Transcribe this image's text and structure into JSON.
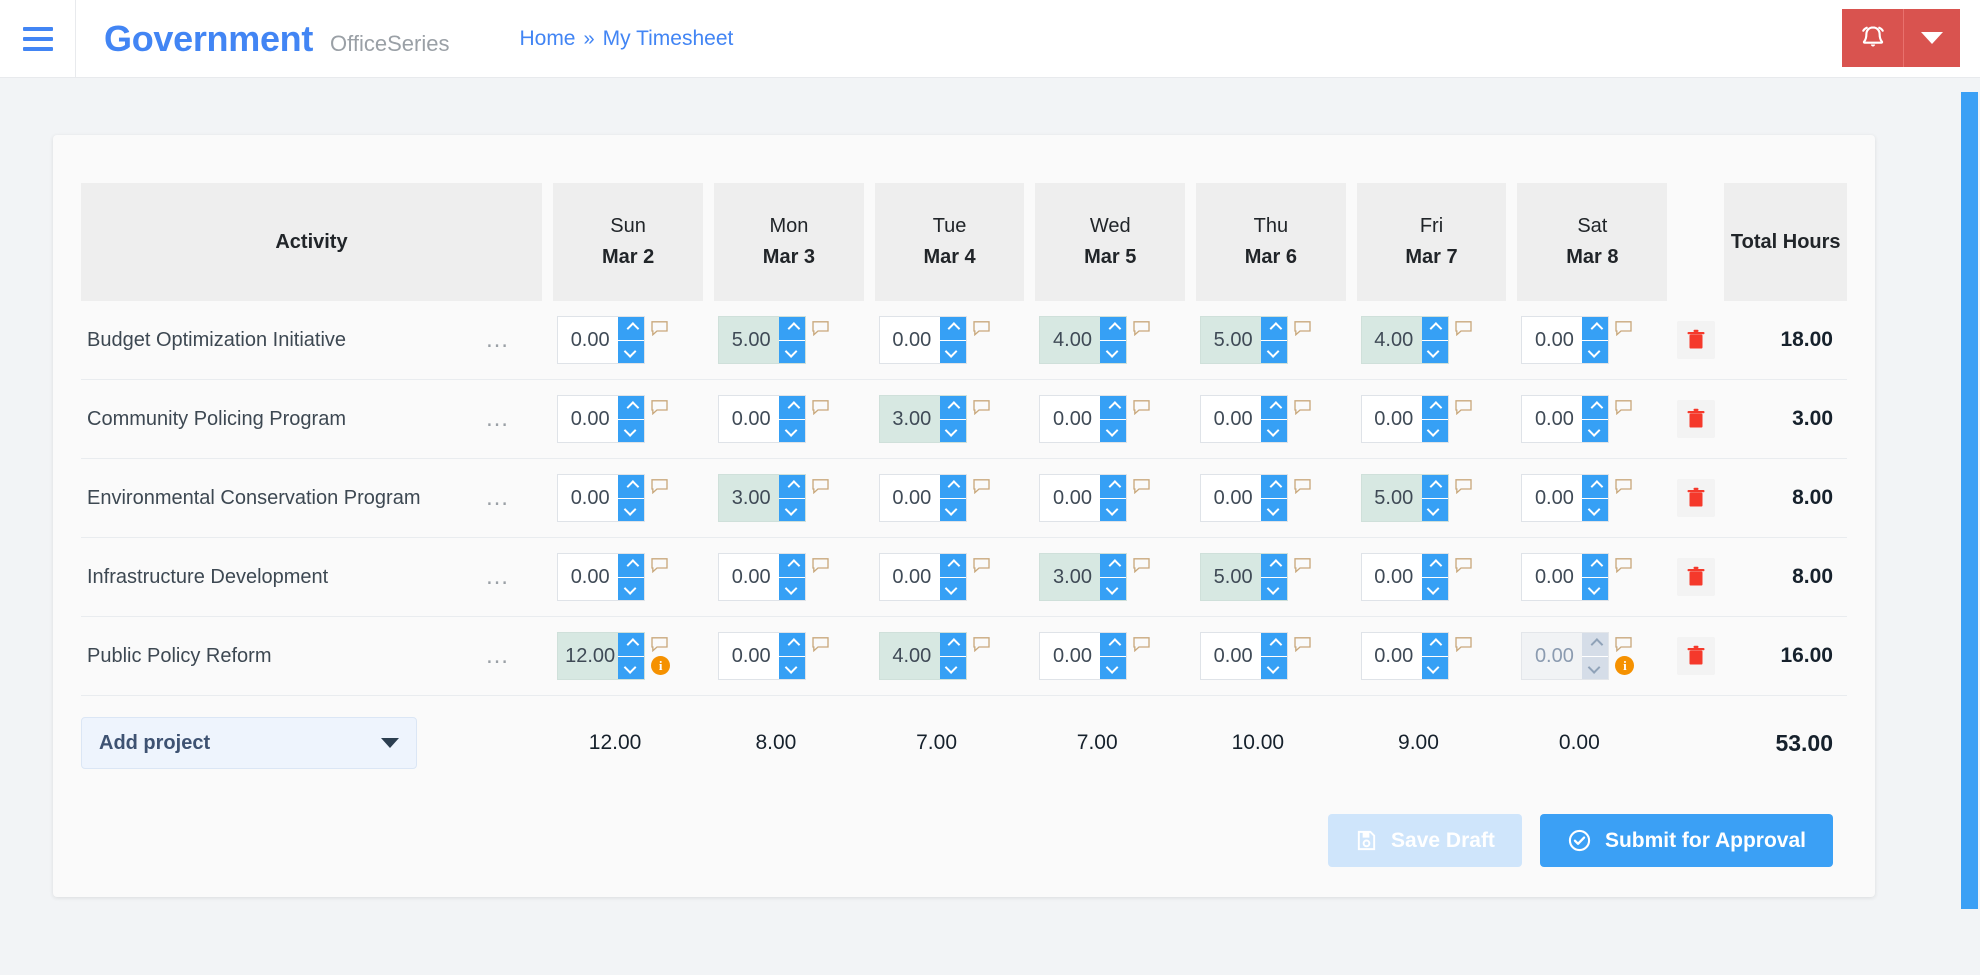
{
  "header": {
    "menu_icon": "hamburger-icon",
    "brand": "Government",
    "brand_sub": "OfficeSeries",
    "breadcrumb": {
      "home": "Home",
      "separator": "»",
      "current": "My Timesheet"
    },
    "notify_icon": "alarm-bell-icon",
    "notify_caret_icon": "chevron-down-icon",
    "accent_red": "#d9534f",
    "accent_blue": "#4285f4"
  },
  "table": {
    "columns": {
      "activity": "Activity",
      "total": "Total Hours",
      "days": [
        {
          "dow": "Sun",
          "date": "Mar 2"
        },
        {
          "dow": "Mon",
          "date": "Mar 3"
        },
        {
          "dow": "Tue",
          "date": "Mar 4"
        },
        {
          "dow": "Wed",
          "date": "Mar 5"
        },
        {
          "dow": "Thu",
          "date": "Mar 6"
        },
        {
          "dow": "Fri",
          "date": "Mar 7"
        },
        {
          "dow": "Sat",
          "date": "Mar 8"
        }
      ]
    },
    "rows": [
      {
        "activity": "Budget Optimization Initiative",
        "menu_icon": "ellipsis-icon",
        "delete_icon": "trash-icon",
        "total": "18.00",
        "cells": [
          {
            "value": "0.00",
            "filled": false,
            "disabled": false,
            "warning": false
          },
          {
            "value": "5.00",
            "filled": true,
            "disabled": false,
            "warning": false
          },
          {
            "value": "0.00",
            "filled": false,
            "disabled": false,
            "warning": false
          },
          {
            "value": "4.00",
            "filled": true,
            "disabled": false,
            "warning": false
          },
          {
            "value": "5.00",
            "filled": true,
            "disabled": false,
            "warning": false
          },
          {
            "value": "4.00",
            "filled": true,
            "disabled": false,
            "warning": false
          },
          {
            "value": "0.00",
            "filled": false,
            "disabled": false,
            "warning": false
          }
        ]
      },
      {
        "activity": "Community Policing Program",
        "menu_icon": "ellipsis-icon",
        "delete_icon": "trash-icon",
        "total": "3.00",
        "cells": [
          {
            "value": "0.00",
            "filled": false,
            "disabled": false,
            "warning": false
          },
          {
            "value": "0.00",
            "filled": false,
            "disabled": false,
            "warning": false
          },
          {
            "value": "3.00",
            "filled": true,
            "disabled": false,
            "warning": false
          },
          {
            "value": "0.00",
            "filled": false,
            "disabled": false,
            "warning": false
          },
          {
            "value": "0.00",
            "filled": false,
            "disabled": false,
            "warning": false
          },
          {
            "value": "0.00",
            "filled": false,
            "disabled": false,
            "warning": false
          },
          {
            "value": "0.00",
            "filled": false,
            "disabled": false,
            "warning": false
          }
        ]
      },
      {
        "activity": "Environmental Conservation Program",
        "menu_icon": "ellipsis-icon",
        "delete_icon": "trash-icon",
        "total": "8.00",
        "cells": [
          {
            "value": "0.00",
            "filled": false,
            "disabled": false,
            "warning": false
          },
          {
            "value": "3.00",
            "filled": true,
            "disabled": false,
            "warning": false
          },
          {
            "value": "0.00",
            "filled": false,
            "disabled": false,
            "warning": false
          },
          {
            "value": "0.00",
            "filled": false,
            "disabled": false,
            "warning": false
          },
          {
            "value": "0.00",
            "filled": false,
            "disabled": false,
            "warning": false
          },
          {
            "value": "5.00",
            "filled": true,
            "disabled": false,
            "warning": false
          },
          {
            "value": "0.00",
            "filled": false,
            "disabled": false,
            "warning": false
          }
        ]
      },
      {
        "activity": "Infrastructure Development",
        "menu_icon": "ellipsis-icon",
        "delete_icon": "trash-icon",
        "total": "8.00",
        "cells": [
          {
            "value": "0.00",
            "filled": false,
            "disabled": false,
            "warning": false
          },
          {
            "value": "0.00",
            "filled": false,
            "disabled": false,
            "warning": false
          },
          {
            "value": "0.00",
            "filled": false,
            "disabled": false,
            "warning": false
          },
          {
            "value": "3.00",
            "filled": true,
            "disabled": false,
            "warning": false
          },
          {
            "value": "5.00",
            "filled": true,
            "disabled": false,
            "warning": false
          },
          {
            "value": "0.00",
            "filled": false,
            "disabled": false,
            "warning": false
          },
          {
            "value": "0.00",
            "filled": false,
            "disabled": false,
            "warning": false
          }
        ]
      },
      {
        "activity": "Public Policy Reform",
        "menu_icon": "ellipsis-icon",
        "delete_icon": "trash-icon",
        "total": "16.00",
        "cells": [
          {
            "value": "12.00",
            "filled": true,
            "disabled": false,
            "warning": true
          },
          {
            "value": "0.00",
            "filled": false,
            "disabled": false,
            "warning": false
          },
          {
            "value": "4.00",
            "filled": true,
            "disabled": false,
            "warning": false
          },
          {
            "value": "0.00",
            "filled": false,
            "disabled": false,
            "warning": false
          },
          {
            "value": "0.00",
            "filled": false,
            "disabled": false,
            "warning": false
          },
          {
            "value": "0.00",
            "filled": false,
            "disabled": false,
            "warning": false
          },
          {
            "value": "0.00",
            "filled": false,
            "disabled": true,
            "warning": true
          }
        ]
      }
    ],
    "footer": {
      "add_project_label": "Add project",
      "add_project_caret_icon": "chevron-down-icon",
      "day_totals": [
        "12.00",
        "8.00",
        "7.00",
        "7.00",
        "10.00",
        "9.00",
        "0.00"
      ],
      "grand_total": "53.00"
    }
  },
  "actions": {
    "save_draft": {
      "label": "Save Draft",
      "icon": "save-disk-icon",
      "disabled": true
    },
    "submit": {
      "label": "Submit for Approval",
      "icon": "check-circle-icon",
      "disabled": false
    }
  },
  "colors": {
    "filled_cell": "#d7e8e2",
    "spinner_blue": "#36a0f5",
    "warning_orange": "#f59100",
    "trash_red": "#f5392b",
    "scrollbar": "#3ba0f5"
  }
}
